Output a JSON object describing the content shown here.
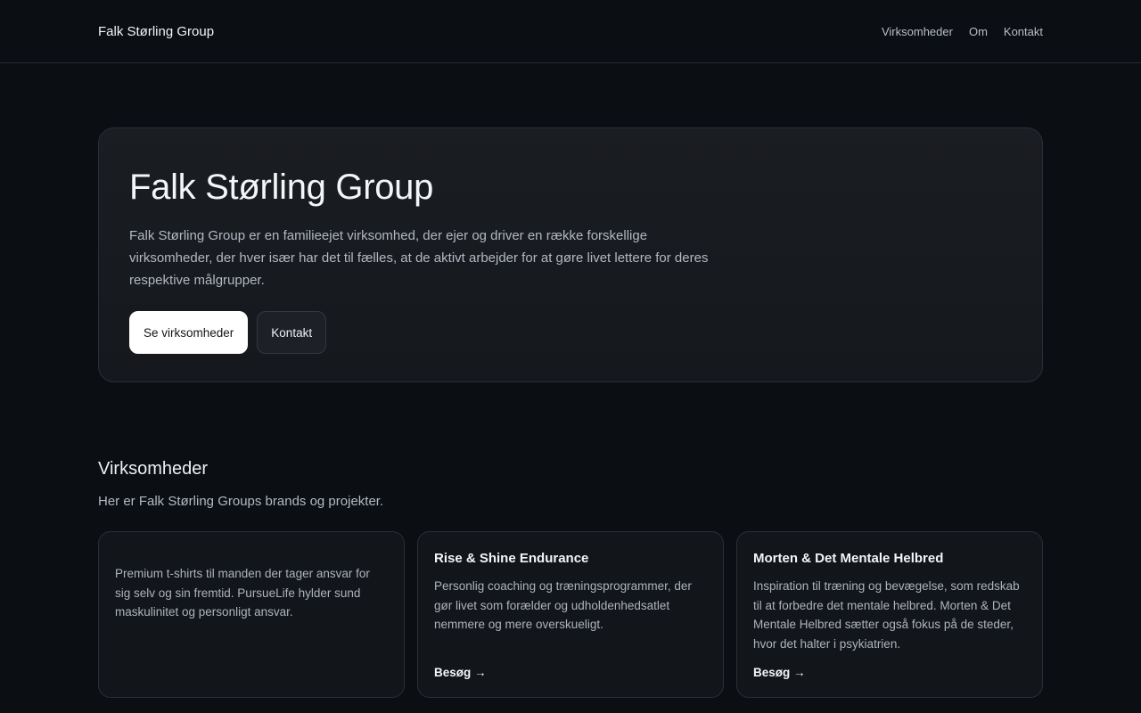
{
  "header": {
    "brand": "Falk Størling Group",
    "nav": [
      "Virksomheder",
      "Om",
      "Kontakt"
    ]
  },
  "hero": {
    "title": "Falk Størling Group",
    "text": "Falk Størling Group er en familieejet virksomhed, der ejer og driver en række forskellige virksomheder, der hver især har det til fælles, at de aktivt arbejder for at gøre livet lettere for deres respektive målgrupper.",
    "primary_button": "Se virksomheder",
    "secondary_button": "Kontakt"
  },
  "companies": {
    "title": "Virksomheder",
    "subtitle": "Her er Falk Størling Groups brands og projekter.",
    "cards": [
      {
        "title": "",
        "text": "Premium t-shirts til manden der tager ansvar for sig selv og sin fremtid. PursueLife hylder sund maskulinitet og personligt ansvar.",
        "link": ""
      },
      {
        "title": "Rise & Shine Endurance",
        "text": "Personlig coaching og træningsprogrammer, der gør livet som forælder og udholdenhedsatlet nemmere og mere overskueligt.",
        "link": "Besøg →"
      },
      {
        "title": "Morten & Det Mentale Helbred",
        "text": "Inspiration til træning og bevægelse, som redskab til at forbedre det mentale helbred. Morten & Det Mentale Helbred sætter også fokus på de steder, hvor det halter i psykiatrien.",
        "link": "Besøg →"
      }
    ]
  },
  "colors": {
    "background": "#0b0f14",
    "card": "#12161b",
    "border": "#2a2f36",
    "text_muted": "#b3b8c1"
  }
}
